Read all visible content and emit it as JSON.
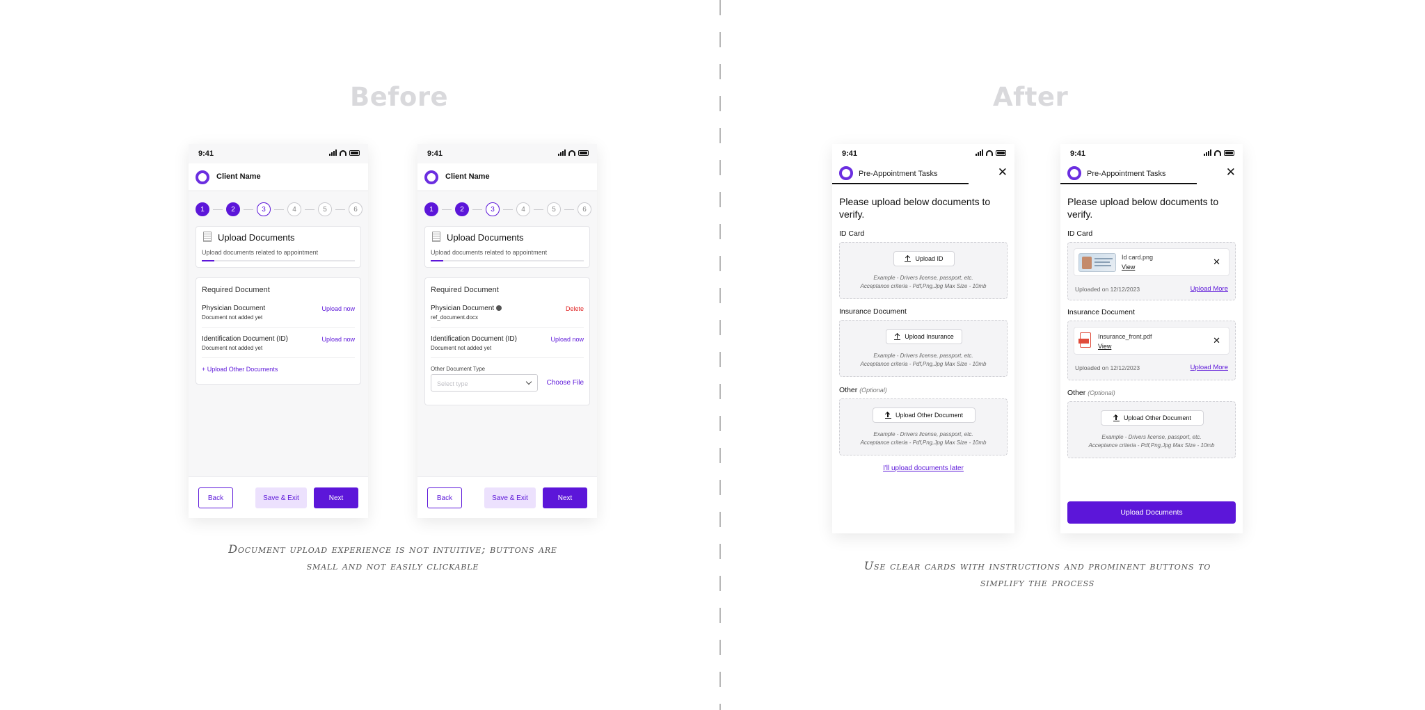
{
  "titles": {
    "before": "Before",
    "after": "After"
  },
  "captions": {
    "before_line1": "Document upload experience is not intuitive; buttons are",
    "before_line2": "small and not easily clickable",
    "after_line1": "Use clear cards with instructions and prominent buttons to",
    "after_line2": "simplify the process"
  },
  "status": {
    "time": "9:41"
  },
  "before": {
    "app_name": "Client Name",
    "steps": [
      "1",
      "2",
      "3",
      "4",
      "5",
      "6"
    ],
    "upload_title": "Upload Documents",
    "upload_subtitle": "Upload documents related to appointment",
    "required_title": "Required Document",
    "physician_label": "Physician Document",
    "not_added": "Document not added yet",
    "id_label": "Identification Document (ID)",
    "upload_now": "Upload now",
    "upload_other": "Upload Other Documents",
    "delete": "Delete",
    "ref_file": "ref_document.docx",
    "other_type_label": "Other Document Type",
    "select_placeholder": "Select type",
    "choose_file": "Choose File",
    "back": "Back",
    "save_exit": "Save & Exit",
    "next": "Next"
  },
  "after": {
    "app_name": "Pre-Appointment Tasks",
    "close_icon": "close-icon",
    "question_line1": "Please upload below documents to",
    "question_line2": "verify.",
    "id_card": "ID Card",
    "upload_id": "Upload ID",
    "hint_line1": "Example - Drivers license, passport, etc.",
    "hint_line2": "Acceptance criteria - Pdf,Png,Jpg Max Size - 10mb",
    "insurance": "Insurance Document",
    "upload_insurance": "Upload Insurance",
    "other": "Other",
    "optional": "(Optional)",
    "upload_other": "Upload Other Document",
    "later_link": "I'll upload documents later",
    "id_file": "Id card.png",
    "insurance_file": "Insurance_front.pdf",
    "view": "View",
    "uploaded_on": "Uploaded on 12/12/2023",
    "upload_more": "Upload More",
    "upload_documents": "Upload Documents"
  }
}
